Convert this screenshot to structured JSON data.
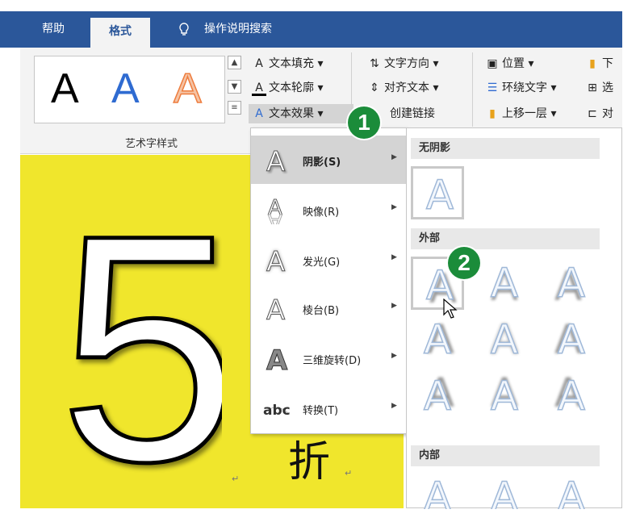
{
  "tabs": {
    "help": "帮助",
    "format": "格式",
    "search": "操作说明搜索"
  },
  "ribbon": {
    "gallery_letter": "A",
    "group_label": "艺术字样式",
    "text_fill": "文本填充 ▾",
    "text_outline": "文本轮廓 ▾",
    "text_effects": "文本效果 ▾",
    "text_direction": "文字方向 ▾",
    "align_text": "对齐文本 ▾",
    "create_link": "创建链接",
    "position": "位置 ▾",
    "wrap_text": "环绕文字 ▾",
    "bring_forward": "上移一层  ▾",
    "send_back": "下",
    "selection_pane": "选",
    "align": "对"
  },
  "document": {
    "big_number": "5",
    "char": "折",
    "para_mark": "↵"
  },
  "effects_menu": {
    "items": [
      {
        "label": "阴影(S)",
        "icon": "shadow-A-icon"
      },
      {
        "label": "映像(R)",
        "icon": "reflection-A-icon"
      },
      {
        "label": "发光(G)",
        "icon": "glow-A-icon"
      },
      {
        "label": "棱台(B)",
        "icon": "bevel-A-icon"
      },
      {
        "label": "三维旋转(D)",
        "icon": "3d-rotation-A-icon"
      },
      {
        "label": "转换(T)",
        "icon": "transform-abc-icon"
      }
    ],
    "submenu_arrow": "▶"
  },
  "shadow_gallery": {
    "no_shadow": "无阴影",
    "outer": "外部",
    "inner": "内部",
    "sample_letter": "A"
  },
  "callouts": {
    "step1": "1",
    "step2": "2"
  },
  "colors": {
    "accent": "#2b579a",
    "callout": "#1b8c3a",
    "canvas": "#f0e62c"
  }
}
